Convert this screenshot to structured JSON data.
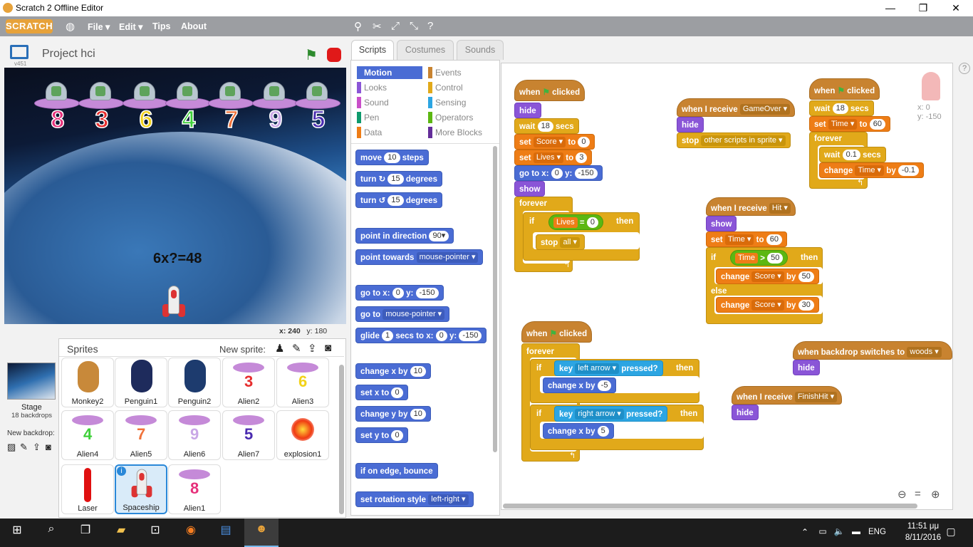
{
  "window": {
    "title": "Scratch 2 Offline Editor",
    "minimize": "—",
    "maximize": "❐",
    "close": "✕"
  },
  "menubar": {
    "logo": "SCRATCH",
    "file": "File ▾",
    "edit": "Edit ▾",
    "tips": "Tips",
    "about": "About"
  },
  "stage": {
    "project_name": "Project hci",
    "version": "v451",
    "question": "6x?=48",
    "coords_x": "x: 240",
    "coords_y": "y: 180",
    "alien_digits": [
      "8",
      "3",
      "6",
      "4",
      "7",
      "9",
      "5"
    ],
    "alien_colors": [
      "#e6307a",
      "#e62d2d",
      "#f2d21a",
      "#3fd03a",
      "#f0723a",
      "#c9a7e6",
      "#4a2bb0"
    ]
  },
  "sprites": {
    "title": "Sprites",
    "new_sprite_label": "New sprite:",
    "stage_label": "Stage",
    "stage_backdrops": "18 backdrops",
    "new_backdrop_label": "New backdrop:",
    "items": [
      {
        "name": "Monkey2"
      },
      {
        "name": "Penguin1"
      },
      {
        "name": "Penguin2"
      },
      {
        "name": "Alien2"
      },
      {
        "name": "Alien3"
      },
      {
        "name": "Alien4"
      },
      {
        "name": "Alien5"
      },
      {
        "name": "Alien6"
      },
      {
        "name": "Alien7"
      },
      {
        "name": "explosion1"
      },
      {
        "name": "Laser"
      },
      {
        "name": "Spaceship"
      },
      {
        "name": "Alien1"
      }
    ]
  },
  "tabs": {
    "scripts": "Scripts",
    "costumes": "Costumes",
    "sounds": "Sounds"
  },
  "categories": {
    "motion": "Motion",
    "looks": "Looks",
    "sound": "Sound",
    "pen": "Pen",
    "data": "Data",
    "events": "Events",
    "control": "Control",
    "sensing": "Sensing",
    "operators": "Operators",
    "more": "More Blocks"
  },
  "palette": {
    "move": "move",
    "move_val": "10",
    "steps": "steps",
    "turn": "turn",
    "degrees": "degrees",
    "turn_val": "15",
    "point_dir": "point in direction",
    "point_dir_val": "90▾",
    "point_towards": "point towards",
    "mouse_pointer": "mouse-pointer ▾",
    "goto": "go to x:",
    "y": "y:",
    "zero": "0",
    "neg150": "-150",
    "goto2": "go to",
    "glide": "glide",
    "one": "1",
    "secs_to_x": "secs to x:",
    "change_x": "change x by",
    "change_y": "change y by",
    "set_x": "set x to",
    "set_y": "set y to",
    "edge": "if on edge, bounce",
    "rot_style": "set rotation style",
    "left_right": "left-right ▾"
  },
  "scripts": {
    "when": "when",
    "clicked": "clicked",
    "hide": "hide",
    "show": "show",
    "wait": "wait",
    "secs": "secs",
    "set": "set",
    "to": "to",
    "by": "by",
    "change": "change",
    "forever": "forever",
    "if": "if",
    "then": "then",
    "else": "else",
    "stop": "stop",
    "all": "all ▾",
    "score": "Score ▾",
    "lives": "Lives ▾",
    "time": "Time ▾",
    "v18": "18",
    "v0": "0",
    "v3": "3",
    "v60": "60",
    "v50": "50",
    "v30": "30",
    "v01": "0.1",
    "vneg01": "-0.1",
    "vneg5": "-5",
    "v5": "5",
    "lives_rep": "Lives",
    "time_rep": "Time",
    "eq": "=",
    "gt": ">",
    "when_receive": "when I receive",
    "gameover": "GameOver ▾",
    "hit": "Hit ▾",
    "finishhit": "FinishHit ▾",
    "other_scripts": "other scripts in sprite ▾",
    "key": "key",
    "pressed": "pressed?",
    "left_arrow": "left arrow ▾",
    "right_arrow": "right arrow ▾",
    "when_backdrop": "when backdrop switches to",
    "woods": "woods ▾",
    "x_label": "x: 0",
    "y_label": "y: -150"
  },
  "taskbar": {
    "lang": "ENG",
    "time": "11:51 μμ",
    "date": "8/11/2016"
  },
  "colors": {
    "motion": "#4a6cd4",
    "looks": "#8a55d7",
    "events": "#c88330",
    "control": "#e1a91a",
    "data": "#ee7d16",
    "sensing": "#2ca5e2",
    "operators": "#5cb712",
    "sound": "#c94fc9",
    "pen": "#0e9a6c",
    "more": "#632d99"
  }
}
